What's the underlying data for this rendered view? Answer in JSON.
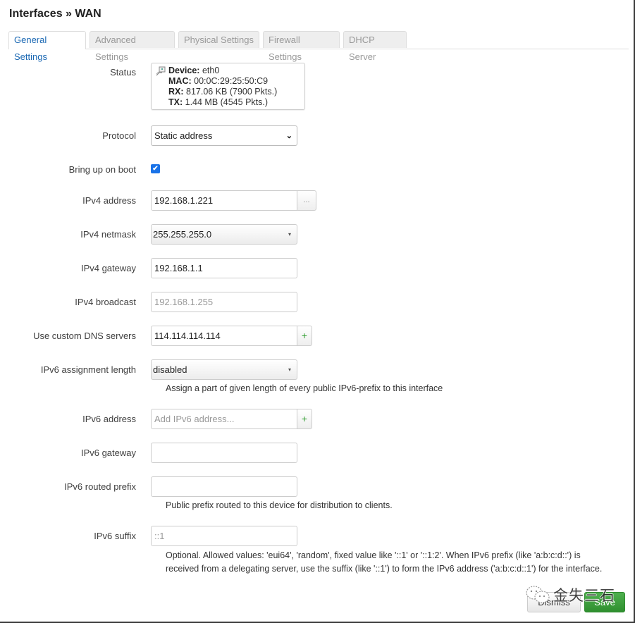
{
  "page": {
    "title": "Interfaces » WAN"
  },
  "tabs": [
    {
      "label": "General Settings",
      "active": true
    },
    {
      "label": "Advanced Settings",
      "active": false
    },
    {
      "label": "Physical Settings",
      "active": false
    },
    {
      "label": "Firewall Settings",
      "active": false
    },
    {
      "label": "DHCP Server",
      "active": false
    }
  ],
  "status": {
    "label": "Status",
    "icon": "ethernet-port-icon",
    "device_key": "Device:",
    "device_val": "eth0",
    "mac_key": "MAC:",
    "mac_val": "00:0C:29:25:50:C9",
    "rx_key": "RX:",
    "rx_val": "817.06 KB (7900 Pkts.)",
    "tx_key": "TX:",
    "tx_val": "1.44 MB (4545 Pkts.)"
  },
  "fields": {
    "protocol": {
      "label": "Protocol",
      "value": "Static address"
    },
    "bring_up": {
      "label": "Bring up on boot",
      "checked": true,
      "check_glyph": "✔"
    },
    "ipv4_address": {
      "label": "IPv4 address",
      "value": "192.168.1.221",
      "addon": "..."
    },
    "ipv4_netmask": {
      "label": "IPv4 netmask",
      "value": "255.255.255.0",
      "arrow": "▾"
    },
    "ipv4_gateway": {
      "label": "IPv4 gateway",
      "value": "192.168.1.1"
    },
    "ipv4_broadcast": {
      "label": "IPv4 broadcast",
      "placeholder": "192.168.1.255"
    },
    "dns": {
      "label": "Use custom DNS servers",
      "value": "114.114.114.114",
      "addon": "+"
    },
    "ipv6_assign": {
      "label": "IPv6 assignment length",
      "value": "disabled",
      "arrow": "▾",
      "description": "Assign a part of given length of every public IPv6-prefix to this interface"
    },
    "ipv6_address": {
      "label": "IPv6 address",
      "placeholder": "Add IPv6 address...",
      "addon": "+"
    },
    "ipv6_gateway": {
      "label": "IPv6 gateway",
      "value": ""
    },
    "ipv6_routed_prefix": {
      "label": "IPv6 routed prefix",
      "value": "",
      "description": "Public prefix routed to this device for distribution to clients."
    },
    "ipv6_suffix": {
      "label": "IPv6 suffix",
      "placeholder": "::1",
      "description_line1": "Optional. Allowed values: 'eui64', 'random', fixed value like '::1' or '::1:2'. When IPv6 prefix (like 'a:b:c:d::') is",
      "description_line2": "received from a delegating server, use the suffix (like '::1') to form the IPv6 address ('a:b:c:d::1') for the interface."
    }
  },
  "buttons": {
    "dismiss": "Dismiss",
    "save": "Save"
  },
  "watermark": {
    "text": "金失三石",
    "icon": "wechat-icon"
  },
  "colors": {
    "accent": "#1b68b3",
    "save": "#3a9a3a",
    "plus": "#2d9c2d",
    "checkbox": "#1a73e8"
  }
}
